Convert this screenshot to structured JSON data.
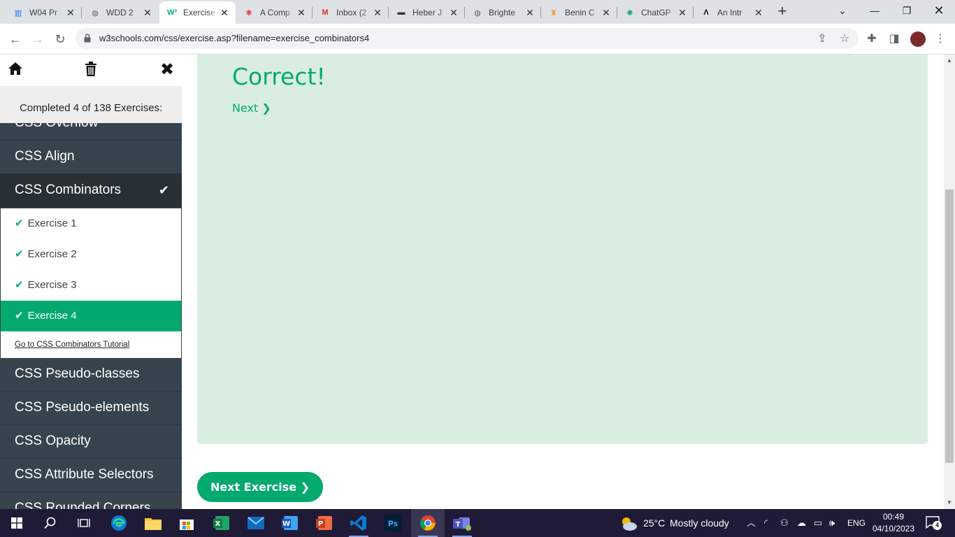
{
  "browser": {
    "tabs": [
      {
        "title": "W04 Pr",
        "icon": "bar-chart-icon",
        "color": "#1a73e8"
      },
      {
        "title": "WDD 2",
        "icon": "globe-icon",
        "color": "#5f6368"
      },
      {
        "title": "Exercise",
        "icon": "w3schools-icon",
        "color": "#04aa6d",
        "active": true
      },
      {
        "title": "A Comp",
        "icon": "asterisk-icon",
        "color": "#e8453c"
      },
      {
        "title": "Inbox (2",
        "icon": "gmail-icon",
        "color": "#d93025"
      },
      {
        "title": "Heber J",
        "icon": "byu-icon",
        "color": "#333333"
      },
      {
        "title": "Brighte",
        "icon": "globe-icon",
        "color": "#5f6368"
      },
      {
        "title": "Benin C",
        "icon": "benin-icon",
        "color": "#e8a317"
      },
      {
        "title": "ChatGP",
        "icon": "chatgpt-icon",
        "color": "#10a37f"
      },
      {
        "title": "An Intr",
        "icon": "a-logo-icon",
        "color": "#0a0a23"
      }
    ],
    "url": "w3schools.com/css/exercise.asp?filename=exercise_combinators4"
  },
  "sidebar": {
    "completed": "Completed 4 of 138 Exercises:",
    "categories_top": [
      {
        "label": "CSS Overflow"
      },
      {
        "label": "CSS Align"
      },
      {
        "label": "CSS Combinators",
        "completed": true
      }
    ],
    "exercises": [
      {
        "label": "Exercise 1"
      },
      {
        "label": "Exercise 2"
      },
      {
        "label": "Exercise 3"
      },
      {
        "label": "Exercise 4"
      }
    ],
    "tutorial_link": "Go to CSS Combinators Tutorial",
    "categories_bottom": [
      {
        "label": "CSS Pseudo-classes"
      },
      {
        "label": "CSS Pseudo-elements"
      },
      {
        "label": "CSS Opacity"
      },
      {
        "label": "CSS Attribute Selectors"
      },
      {
        "label": "CSS Rounded Corners"
      }
    ]
  },
  "main": {
    "result_title": "Correct!",
    "next_link": "Next ❯",
    "next_exercise_button": "Next Exercise ❯"
  },
  "taskbar": {
    "weather_temp": "25°C",
    "weather_desc": "Mostly cloudy",
    "language": "ENG",
    "time": "00:49",
    "date": "04/10/2023",
    "notification_count": "4"
  }
}
